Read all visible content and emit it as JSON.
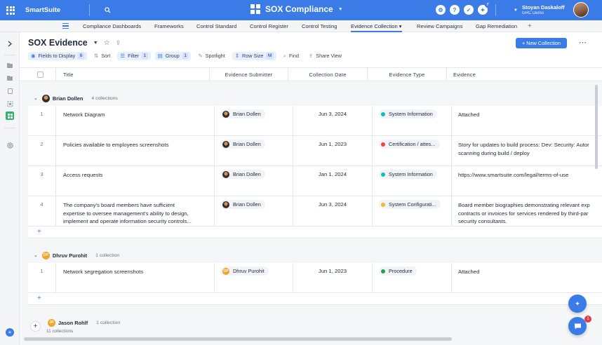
{
  "topbar": {
    "brand": "SmartSuite",
    "app_title": "SOX Compliance",
    "notification_count": "7",
    "user_name": "Stoyan Daskaloff",
    "user_org": "GRC Demo"
  },
  "nav": {
    "tabs": [
      {
        "label": "Compliance Dashboards"
      },
      {
        "label": "Frameworks"
      },
      {
        "label": "Control Standard"
      },
      {
        "label": "Control Register"
      },
      {
        "label": "Control Testing"
      },
      {
        "label": "Evidence Collection ▾"
      },
      {
        "label": "Review Campaigns"
      },
      {
        "label": "Gap Remediation"
      }
    ],
    "active_tab": "Evidence Collection"
  },
  "view": {
    "title": "SOX Evidence",
    "new_button": "+ New Collection",
    "toolbar": {
      "fields_label": "Fields to Display",
      "fields_count": "6",
      "sort_label": "Sort",
      "filter_label": "Filter",
      "filter_count": "1",
      "group_label": "Group",
      "group_count": "1",
      "spotlight_label": "Spotlight",
      "rowsize_label": "Row Size",
      "rowsize_value": "M",
      "find_label": "Find",
      "share_label": "Share View"
    }
  },
  "table": {
    "columns": [
      "Title",
      "Evidence Submitter",
      "Collection Date",
      "Evidence Type",
      "Evidence"
    ],
    "groups": [
      {
        "name": "Brian Dollen",
        "count_label": "4 collections",
        "rows": [
          {
            "num": "1",
            "title": "Network Diagram",
            "submitter": "Brian Dollen",
            "date": "Jun 3, 2024",
            "type": "System Information",
            "evidence": "Attached"
          },
          {
            "num": "2",
            "title": "Policies available to employees screenshots",
            "submitter": "Brian Dollen",
            "date": "Jun 1, 2023",
            "type": "Certification / attes...",
            "evidence": "Story for updates to build process: Dev: Security: Autor",
            "evidence2": "scanning during build / deploy"
          },
          {
            "num": "3",
            "title": "Access requests",
            "submitter": "Brian Dollen",
            "date": "Jan 1, 2024",
            "type": "System Information",
            "evidence": "https://www.smartsuite.com/legal/terms-of-use"
          },
          {
            "num": "4",
            "title": "The company's board members have sufficient",
            "title2": "expertise to oversee management's ability to design,",
            "title3": "implement and operate information security controls...",
            "submitter": "Brian Dollen",
            "date": "Jun 3, 2024",
            "type": "System Configurati...",
            "evidence": "Board member biographies demonstrating relevant exp",
            "evidence2": "contracts or invoices for services rendered by third-par",
            "evidence3": "security consultants."
          }
        ]
      },
      {
        "name": "Dhruv Purohit",
        "initials": "DP",
        "count_label": "1 collection",
        "rows": [
          {
            "num": "1",
            "title": "Network segregation screenshots",
            "submitter": "Dhruv Purohit",
            "date": "Jun 1, 2023",
            "type": "Procedure",
            "evidence": "Attached"
          }
        ]
      },
      {
        "name": "Jason Rohlf",
        "initials": "JR",
        "count_label": "1 collection"
      }
    ],
    "total_label": "11 collections"
  },
  "chat_badge": "1",
  "colors": {
    "accent": "#3b7be8",
    "type_system_information": "#14b8c8",
    "type_certification": "#ef4444",
    "type_system_configuration": "#f5b82e",
    "type_procedure": "#22a24a"
  }
}
